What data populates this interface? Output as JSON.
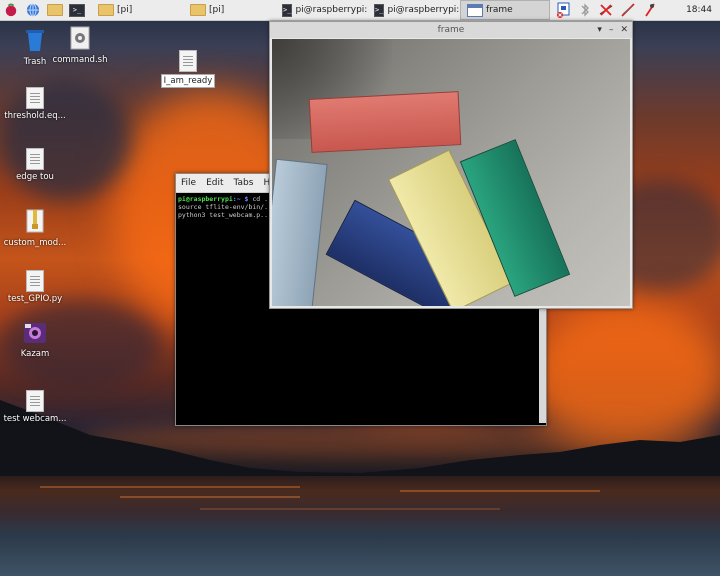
{
  "taskbar": {
    "menu_icon": "raspberry-pi-menu-icon",
    "quick_launch": [
      "web-browser-icon",
      "file-manager-icon",
      "terminal-icon"
    ],
    "tasks": [
      {
        "label": "[pi]",
        "icon": "folder-icon",
        "active": false
      },
      {
        "label": "[pi]",
        "icon": "folder-icon",
        "active": false
      },
      {
        "label": "pi@raspberrypi: ...",
        "icon": "terminal-icon",
        "active": false
      },
      {
        "label": "pi@raspberrypi: ~",
        "icon": "terminal-icon",
        "active": false
      },
      {
        "label": "frame",
        "icon": "frame-icon",
        "active": true
      }
    ],
    "tray": [
      "vnc-icon",
      "bluetooth-icon",
      "network-disconnected-icon",
      "volume-muted-icon",
      "audio-icon"
    ],
    "clock": "18:44"
  },
  "desktop_icons": [
    {
      "label": "Trash",
      "icon": "trash-icon"
    },
    {
      "label": "command.sh",
      "icon": "script-icon"
    },
    {
      "label": "I_am_ready",
      "icon": "document-icon"
    },
    {
      "label": "threshold.eq...",
      "icon": "document-icon"
    },
    {
      "label": "edge tou",
      "icon": "document-icon"
    },
    {
      "label": "custom_mod...",
      "icon": "archive-icon"
    },
    {
      "label": "test_GPIO.py",
      "icon": "document-icon"
    },
    {
      "label": "Kazam",
      "icon": "kazam-icon"
    },
    {
      "label": "test webcam...",
      "icon": "document-icon"
    }
  ],
  "terminal": {
    "menu": [
      "File",
      "Edit",
      "Tabs",
      "Help"
    ],
    "lines": [
      {
        "user": "pi@raspberrypi",
        "path": ":~ $",
        "cmd": " cd ..."
      },
      {
        "text": "source tflite-env/bin/..."
      },
      {
        "text": "python3 test_webcam.p..."
      }
    ]
  },
  "frame_window": {
    "title": "frame",
    "controls": [
      "▾",
      "–",
      "✕"
    ]
  },
  "colors": {
    "taskbar_bg": "#ececec",
    "terminal_bg": "#000000",
    "prompt_user": "#4ee14e",
    "prompt_path": "#6b8cff",
    "block_red": "#d0625a",
    "block_blue": "#253a7c",
    "block_yellow": "#e6dd93",
    "block_green": "#1f8f6c",
    "block_lightblue": "#9fb4c6"
  }
}
